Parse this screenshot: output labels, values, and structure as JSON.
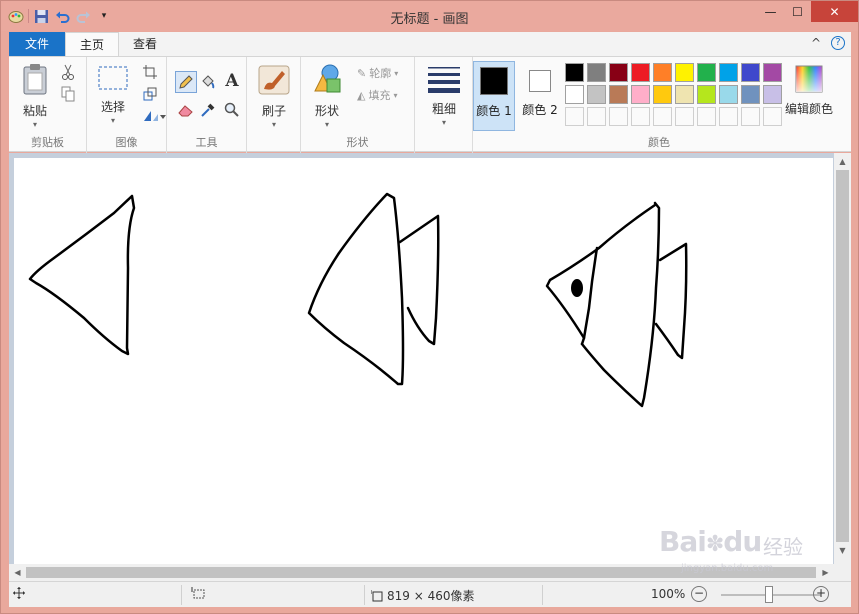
{
  "window": {
    "title": "无标题 - 画图",
    "minimize": "—",
    "maximize": "☐",
    "close": "✕"
  },
  "menu": {
    "file": "文件",
    "home": "主页",
    "view": "查看",
    "collapse_glyph": "^",
    "help_glyph": "?"
  },
  "ribbon": {
    "clipboard": {
      "label": "剪贴板",
      "paste": "粘贴"
    },
    "image": {
      "label": "图像",
      "select": "选择"
    },
    "tools": {
      "label": "工具"
    },
    "brushes": {
      "brush": "刷子"
    },
    "shapes": {
      "label": "形状",
      "shapes_btn": "形状",
      "outline": "轮廓",
      "fill": "填充"
    },
    "size": {
      "label": "粗细"
    },
    "colors": {
      "label": "颜色",
      "color1": "颜色 1",
      "color2": "颜色 2",
      "edit_colors": "编辑颜色",
      "color1_value": "#000000",
      "color2_value": "#ffffff",
      "palette_row1": [
        "#000000",
        "#7f7f7f",
        "#880015",
        "#ed1c24",
        "#ff7f27",
        "#fff200",
        "#22b14c",
        "#00a2e8",
        "#3f48cc",
        "#a349a4"
      ],
      "palette_row2": [
        "#ffffff",
        "#c3c3c3",
        "#b97a57",
        "#ffaec9",
        "#ffc90e",
        "#efe4b0",
        "#b5e61d",
        "#99d9ea",
        "#7092be",
        "#c8bfe7"
      ]
    }
  },
  "statusbar": {
    "dimensions": "819 × 460像素",
    "zoom": "100%",
    "zoom_out": "−",
    "zoom_in": "+"
  },
  "watermark": {
    "brand": "Bai",
    "brand_suffix": "du",
    "cn": "经验",
    "url": "jingyan.baidu.com"
  }
}
